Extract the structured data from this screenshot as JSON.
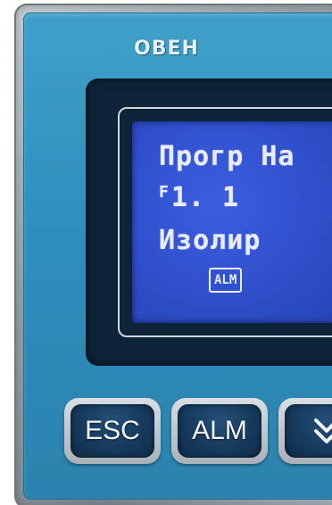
{
  "device": {
    "brand": "ОВЕН",
    "brand_display": "ОВЕН"
  },
  "lcd": {
    "line1": "Прогр На",
    "line2_prefix": "F",
    "line2_value": "1. 1",
    "line3": "Изолир",
    "badge": "ALM"
  },
  "keys": {
    "esc": "ESC",
    "alm": "ALM",
    "down_icon": "double-chevron-down-icon"
  },
  "colors": {
    "panel": "#2e8fbb",
    "lcd_background": "#2f4fcb",
    "lcd_text": "#e9ecff",
    "key_face": "#163a5d"
  }
}
